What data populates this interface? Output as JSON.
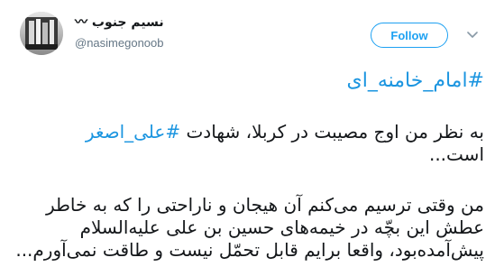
{
  "header": {
    "display_name": "نسیم جنوب 〰",
    "handle": "@nasimegonoob",
    "follow_label": "Follow"
  },
  "tweet": {
    "hashtag": "#امام_خامنه_ای",
    "paragraph1": {
      "line1_before": "به نظر من اوج مصیبت در کربلا، شهادت ",
      "line1_hashtag": "#علی_اصغر",
      "line2": "است..."
    },
    "paragraph2": {
      "line1": "من وقتی ترسیم می‌کنم آن هیجان و ناراحتی را که به خاطر",
      "line2": "عطش این بچّه در خیمه‌های حسین بن علی علیه‌السلام",
      "line3": "پیش‌آمده‌بود، واقعا برایم قابل تحمّل نیست و طاقت نمی‌آورم..."
    }
  },
  "icons": {
    "avatar": "profile-photo-icon",
    "caret": "chevron-down-icon"
  },
  "colors": {
    "link": "#1b95e0",
    "follow_border": "#1da1f2",
    "muted": "#657786",
    "text": "#14171a"
  }
}
